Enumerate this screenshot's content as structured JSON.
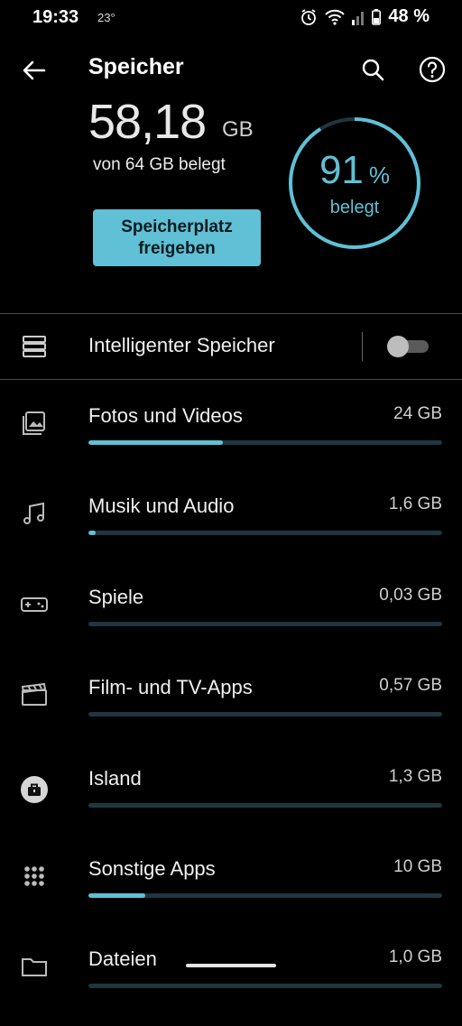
{
  "status_bar": {
    "time": "19:33",
    "temperature": "23°",
    "battery_text": "48 %",
    "icons": [
      "alarm-icon",
      "wifi-icon",
      "signal-icon",
      "battery-icon"
    ]
  },
  "app_bar": {
    "title": "Speicher",
    "icons": [
      "back-arrow-icon",
      "search-icon",
      "help-icon"
    ]
  },
  "summary": {
    "used_value": "58,18",
    "used_unit": "GB",
    "of_total_text": "von 64 GB belegt",
    "free_button_label": "Speicherplatz freigeben",
    "percent_value": "91",
    "percent_unit": "%",
    "percent_label": "belegt",
    "percent_used": 0.91
  },
  "smart_storage": {
    "label": "Intelligenter Speicher",
    "enabled": false
  },
  "categories": [
    {
      "label": "Fotos und Videos",
      "size": "24 GB",
      "icon": "photo-icon",
      "fraction": 0.38
    },
    {
      "label": "Musik und Audio",
      "size": "1,6 GB",
      "icon": "music-icon",
      "fraction": 0.02
    },
    {
      "label": "Spiele",
      "size": "0,03 GB",
      "icon": "gamepad-icon",
      "fraction": 0.0
    },
    {
      "label": "Film- und TV-Apps",
      "size": "0,57 GB",
      "icon": "movie-icon",
      "fraction": 0.0
    },
    {
      "label": "Island",
      "size": "1,3 GB",
      "icon": "briefcase-icon",
      "fraction": 0.0
    },
    {
      "label": "Sonstige Apps",
      "size": "10 GB",
      "icon": "apps-grid-icon",
      "fraction": 0.16
    },
    {
      "label": "Dateien",
      "size": "1,0 GB",
      "icon": "folder-icon",
      "fraction": 0.0
    }
  ],
  "colors": {
    "background": "#000000",
    "accent": "#5fc0d6",
    "bar_track": "#1f3640",
    "ring_track": "#1f3640"
  }
}
